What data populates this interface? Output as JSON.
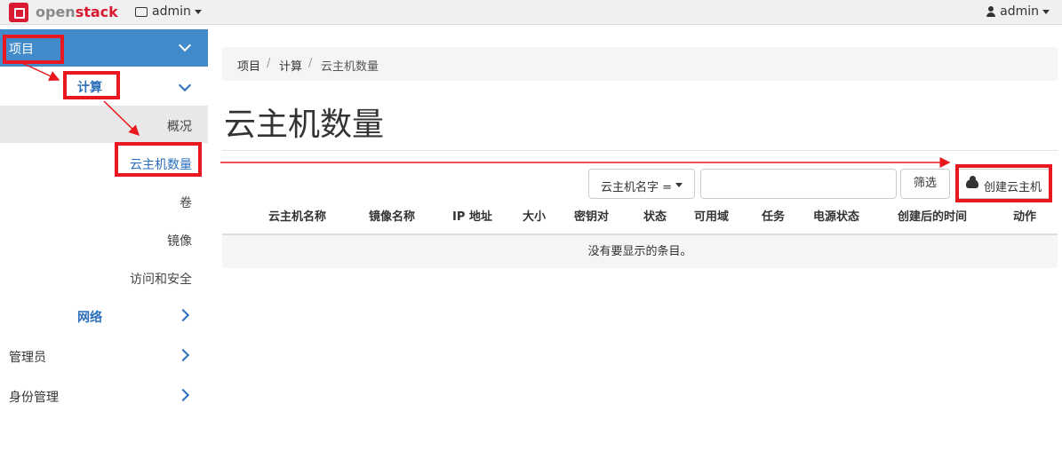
{
  "header": {
    "logo_text_a": "open",
    "logo_text_b": "stack",
    "project_label": "admin",
    "user_label": "admin"
  },
  "sidebar": {
    "top": "项目",
    "compute": "计算",
    "subitems": [
      "概况",
      "云主机数量",
      "卷",
      "镜像",
      "访问和安全"
    ],
    "network": "网络",
    "admin": "管理员",
    "identity": "身份管理"
  },
  "breadcrumb": [
    "项目",
    "计算",
    "云主机数量"
  ],
  "page_title": "云主机数量",
  "toolbar": {
    "filter_field": "云主机名字 =",
    "search_value": "",
    "filter_button": "筛选",
    "launch_button": "创建云主机"
  },
  "table": {
    "headers": [
      "云主机名称",
      "镜像名称",
      "IP 地址",
      "大小",
      "密钥对",
      "状态",
      "可用域",
      "任务",
      "电源状态",
      "创建后的时间",
      "动作"
    ],
    "empty_message": "没有要显示的条目。"
  },
  "colors": {
    "accent": "#428bca",
    "highlight": "#e8181e",
    "brand": "#da1a32"
  }
}
